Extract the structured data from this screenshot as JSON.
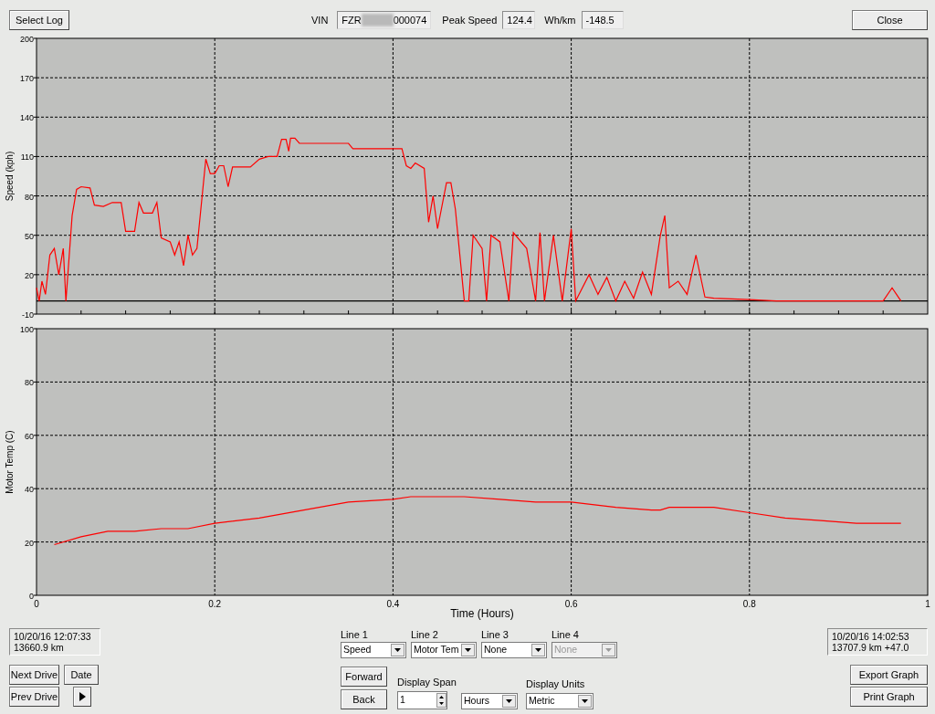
{
  "toolbar": {
    "select_log": "Select Log",
    "vin_label": "VIN",
    "vin": {
      "prefix": "FZR",
      "suffix": "000074",
      "redacted": true
    },
    "peak_label": "Peak Speed",
    "peak": "124.4",
    "whkm_label": "Wh/km",
    "whkm": "-148.5",
    "close": "Close"
  },
  "speed_panel": {
    "chart_data": {
      "type": "line",
      "ylabel": "Speed (kph)",
      "xlim": [
        0,
        1
      ],
      "ylim": [
        -10,
        200
      ],
      "yticks": [
        -10,
        20,
        50,
        80,
        110,
        140,
        170,
        200
      ],
      "grid": true,
      "x": [
        0,
        0.003,
        0.006,
        0.01,
        0.015,
        0.02,
        0.025,
        0.03,
        0.033,
        0.04,
        0.045,
        0.05,
        0.06,
        0.065,
        0.075,
        0.085,
        0.095,
        0.1,
        0.11,
        0.115,
        0.12,
        0.13,
        0.135,
        0.14,
        0.15,
        0.155,
        0.16,
        0.165,
        0.17,
        0.175,
        0.18,
        0.19,
        0.195,
        0.2,
        0.205,
        0.21,
        0.215,
        0.22,
        0.24,
        0.25,
        0.26,
        0.27,
        0.275,
        0.28,
        0.283,
        0.285,
        0.29,
        0.295,
        0.35,
        0.355,
        0.41,
        0.415,
        0.42,
        0.425,
        0.435,
        0.44,
        0.445,
        0.45,
        0.46,
        0.465,
        0.47,
        0.48,
        0.485,
        0.49,
        0.5,
        0.505,
        0.51,
        0.52,
        0.53,
        0.535,
        0.55,
        0.56,
        0.565,
        0.57,
        0.58,
        0.59,
        0.6,
        0.605,
        0.62,
        0.63,
        0.64,
        0.65,
        0.66,
        0.67,
        0.68,
        0.69,
        0.7,
        0.705,
        0.71,
        0.72,
        0.73,
        0.74,
        0.75,
        0.76,
        0.8,
        0.83,
        0.95,
        0.96,
        0.965,
        0.97
      ],
      "series": [
        {
          "color": "#ff0000",
          "values": [
            10,
            0,
            15,
            5,
            35,
            40,
            20,
            40,
            0,
            65,
            85,
            87,
            86,
            73,
            72,
            75,
            75,
            53,
            53,
            75,
            67,
            67,
            75,
            48,
            45,
            35,
            45,
            27,
            50,
            35,
            40,
            108,
            97,
            97,
            103,
            103,
            87,
            102,
            102,
            108,
            110,
            110,
            123,
            123,
            114,
            124,
            124,
            120,
            120,
            116,
            116,
            103,
            101,
            105,
            101,
            60,
            80,
            55,
            90,
            90,
            70,
            0,
            0,
            50,
            40,
            0,
            50,
            45,
            0,
            52,
            40,
            0,
            52,
            0,
            50,
            0,
            55,
            0,
            20,
            5,
            18,
            0,
            15,
            2,
            22,
            5,
            50,
            65,
            10,
            15,
            5,
            35,
            3,
            2,
            1,
            0,
            0,
            10,
            5,
            0
          ]
        }
      ]
    }
  },
  "temp_panel": {
    "chart_data": {
      "type": "line",
      "xlabel": "Time (Hours)",
      "ylabel": "Motor Temp (C)",
      "xlim": [
        0,
        1
      ],
      "ylim": [
        0,
        100
      ],
      "yticks": [
        0,
        20,
        40,
        60,
        80,
        100
      ],
      "xticks": [
        0,
        0.2,
        0.4,
        0.6,
        0.8,
        1
      ],
      "grid": true,
      "x": [
        0.02,
        0.05,
        0.08,
        0.11,
        0.14,
        0.17,
        0.2,
        0.25,
        0.3,
        0.35,
        0.4,
        0.42,
        0.48,
        0.52,
        0.56,
        0.6,
        0.65,
        0.69,
        0.7,
        0.71,
        0.73,
        0.76,
        0.8,
        0.84,
        0.88,
        0.92,
        0.96,
        0.97
      ],
      "series": [
        {
          "color": "#ff0000",
          "values": [
            19,
            22,
            24,
            24,
            25,
            25,
            27,
            29,
            32,
            35,
            36,
            37,
            37,
            36,
            35,
            35,
            33,
            32,
            32,
            33,
            33,
            33,
            31,
            29,
            28,
            27,
            27,
            27
          ]
        }
      ]
    }
  },
  "start_info": [
    "10/20/16 12:07:33",
    "13660.9 km"
  ],
  "end_info": [
    "10/20/16 14:02:53",
    "13707.9 km +47.0"
  ],
  "nav_buttons": {
    "next": "Next Drive",
    "date": "Date",
    "prev": "Prev Drive"
  },
  "lines": [
    {
      "label": "Line 1",
      "value": "Speed",
      "disabled": false
    },
    {
      "label": "Line 2",
      "value": "Motor Tem",
      "disabled": false
    },
    {
      "label": "Line 3",
      "value": "None",
      "disabled": false
    },
    {
      "label": "Line 4",
      "value": "None",
      "disabled": true
    }
  ],
  "forward": "Forward",
  "back": "Back",
  "span": {
    "label": "Display Span",
    "value": "1",
    "unit": "Hours"
  },
  "units": {
    "label": "Display Units",
    "value": "Metric"
  },
  "export": "Export Graph",
  "print": "Print Graph"
}
